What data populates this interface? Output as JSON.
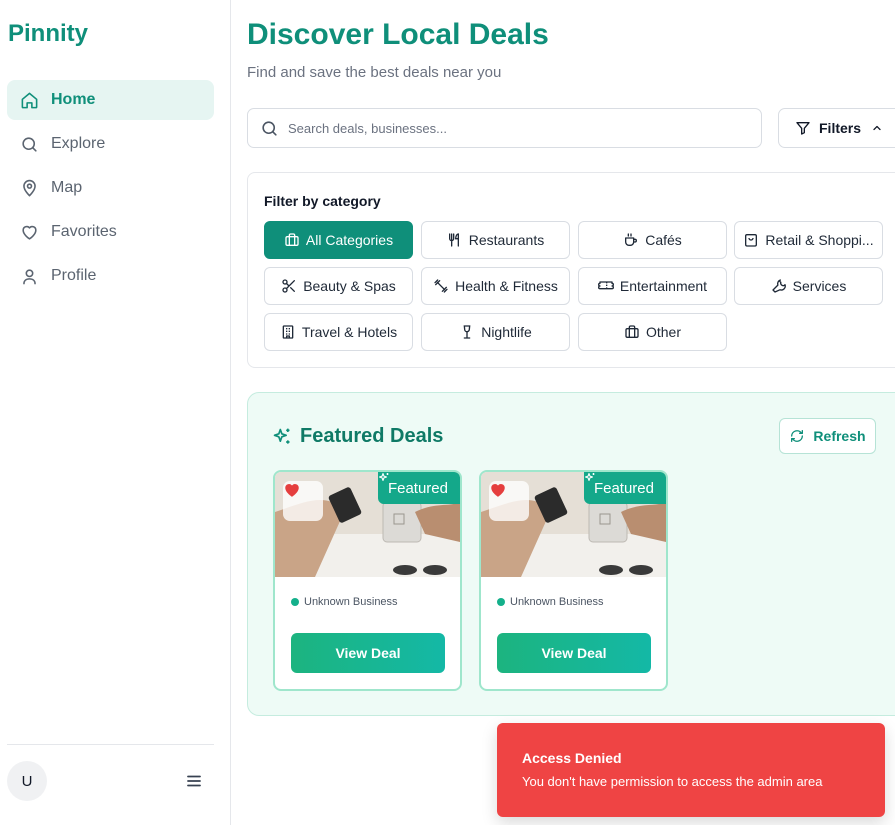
{
  "app": {
    "brand": "Pinnity"
  },
  "sidebar": {
    "items": [
      {
        "label": "Home",
        "icon": "home-icon",
        "active": true
      },
      {
        "label": "Explore",
        "icon": "search-icon",
        "active": false
      },
      {
        "label": "Map",
        "icon": "map-pin-icon",
        "active": false
      },
      {
        "label": "Favorites",
        "icon": "heart-icon",
        "active": false
      },
      {
        "label": "Profile",
        "icon": "user-icon",
        "active": false
      }
    ],
    "avatar_initial": "U"
  },
  "header": {
    "title": "Discover Local Deals",
    "subtitle": "Find and save the best deals near you"
  },
  "search": {
    "placeholder": "Search deals, businesses...",
    "value": ""
  },
  "filters": {
    "label": "Filters",
    "expanded": true
  },
  "categories": {
    "title": "Filter by category",
    "items": [
      {
        "label": "All Categories",
        "icon": "shopping-bag-icon",
        "active": true
      },
      {
        "label": "Restaurants",
        "icon": "utensils-icon",
        "active": false
      },
      {
        "label": "Cafés",
        "icon": "coffee-icon",
        "active": false
      },
      {
        "label": "Retail & Shoppi...",
        "icon": "bag-icon",
        "active": false
      },
      {
        "label": "Beauty & Spas",
        "icon": "scissors-icon",
        "active": false
      },
      {
        "label": "Health & Fitness",
        "icon": "dumbbell-icon",
        "active": false
      },
      {
        "label": "Entertainment",
        "icon": "ticket-icon",
        "active": false
      },
      {
        "label": "Services",
        "icon": "wrench-icon",
        "active": false
      },
      {
        "label": "Travel & Hotels",
        "icon": "building-icon",
        "active": false
      },
      {
        "label": "Nightlife",
        "icon": "wine-glass-icon",
        "active": false
      },
      {
        "label": "Other",
        "icon": "briefcase-icon",
        "active": false
      }
    ]
  },
  "featured": {
    "title": "Featured Deals",
    "refresh_label": "Refresh",
    "deals": [
      {
        "badge": "Featured",
        "business": "Unknown Business",
        "cta": "View Deal"
      },
      {
        "badge": "Featured",
        "business": "Unknown Business",
        "cta": "View Deal"
      }
    ]
  },
  "toast": {
    "title": "Access Denied",
    "message": "You don't have permission to access the admin area"
  },
  "colors": {
    "brand": "#0f8f7a",
    "active_bg": "#e6f5f2",
    "featured_bg": "#eefbf6",
    "toast_bg": "#ef4444",
    "favorite": "#e53e3e"
  }
}
